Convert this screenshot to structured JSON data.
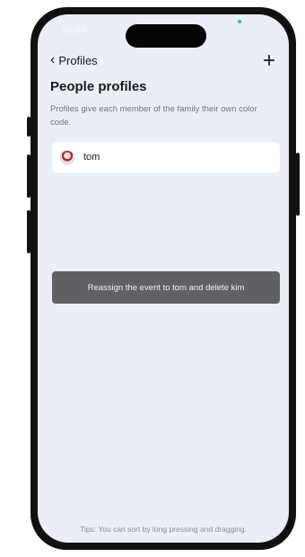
{
  "status_bar": {
    "time": "15:56",
    "signal_icons": "••  ≋  ▭"
  },
  "nav": {
    "back_label": "Profiles",
    "back_icon": "chevron-left-icon",
    "add_icon": "plus-icon"
  },
  "page": {
    "title": "People profiles",
    "subtitle": "Profiles give each member of the family their own color code."
  },
  "profiles": [
    {
      "name": "tom",
      "avatar_icon": "avatar-icon"
    }
  ],
  "toast": {
    "message": "Reassign the event to tom and delete kim"
  },
  "footer": {
    "tips": "Tips: You can sort by long pressing and dragging."
  },
  "colors": {
    "background": "#eaeef7",
    "toast_bg": "#5f6165",
    "card_bg": "#ffffff"
  }
}
